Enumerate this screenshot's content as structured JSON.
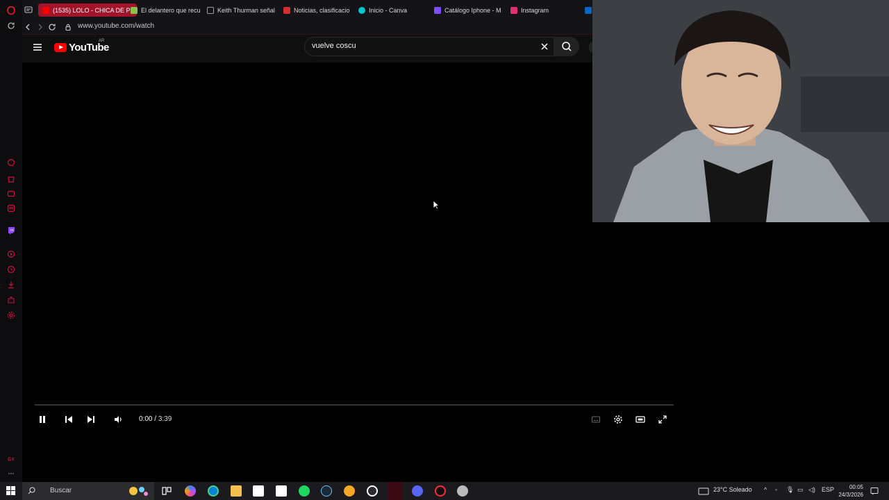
{
  "browser": {
    "tabs": [
      {
        "label": "(1535) LOLO - CHICA DE P",
        "active": true,
        "favicon_color": "#ff0000"
      },
      {
        "label": "El delantero que recu",
        "active": false,
        "favicon_color": "#8bc34a"
      },
      {
        "label": "Keith Thurman señal",
        "active": false,
        "favicon_color": "#9e9e9e"
      },
      {
        "label": "Noticias, clasificacio",
        "active": false,
        "favicon_color": "#d32f2f"
      },
      {
        "label": "Inicio - Canva",
        "active": false,
        "favicon_color": "#00c4cc"
      },
      {
        "label": "Catálogo Iphone - M",
        "active": false,
        "favicon_color": "#7c4dff"
      },
      {
        "label": "Instagram",
        "active": false,
        "favicon_color": "#e1306c"
      }
    ],
    "url": "www.youtube.com/watch",
    "accent": "#a1142a"
  },
  "youtube": {
    "logo_text": "YouTube",
    "region": "AR",
    "search_value": "vuelve coscu"
  },
  "player": {
    "time_current": "0:00",
    "time_separator": " / ",
    "time_duration": "3:39",
    "progress_fraction": 0.0,
    "playing": true
  },
  "taskbar": {
    "search_placeholder": "Buscar",
    "weather": "23°C  Soleado",
    "language": "ESP",
    "time": "00:05",
    "date": "24/3/2026"
  }
}
